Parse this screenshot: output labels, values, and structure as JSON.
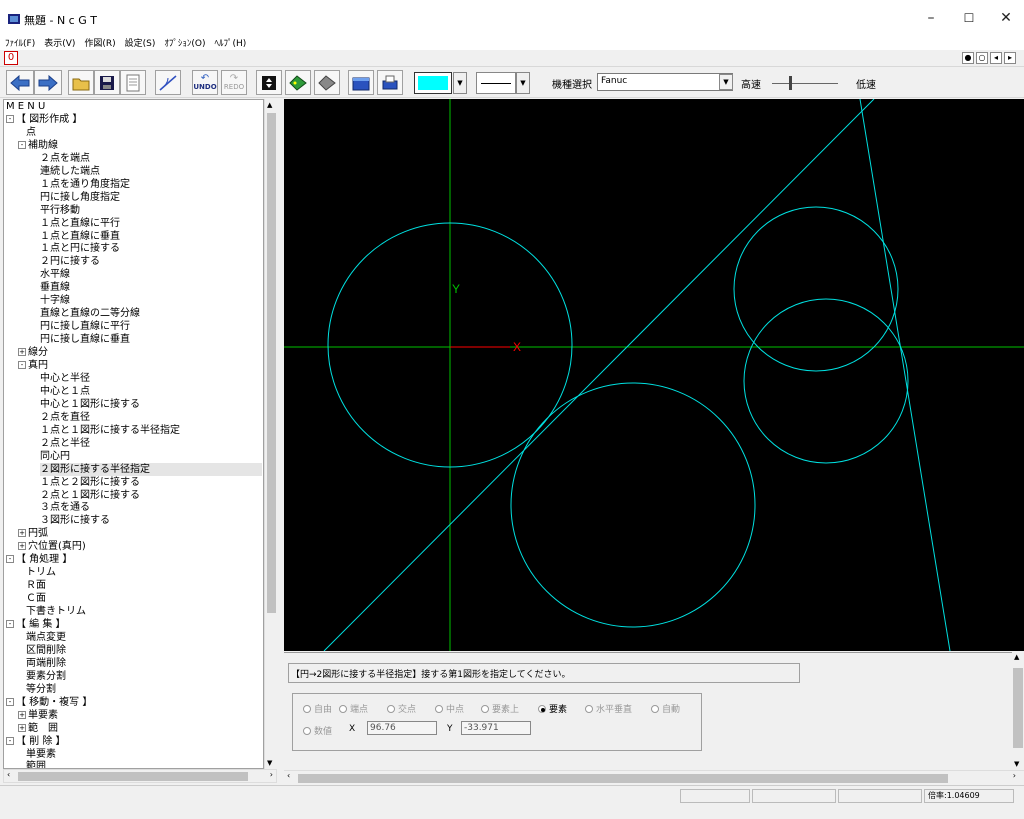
{
  "window": {
    "title": "無題 - N c G T",
    "minimize": "–",
    "maximize": "☐",
    "close": "✕"
  },
  "menu": [
    "ﾌｧｲﾙ(F)",
    "表示(V)",
    "作図(R)",
    "設定(S)",
    "ｵﾌﾟｼｮﾝ(O)",
    "ﾍﾙﾌﾟ(H)"
  ],
  "doc_tab": "0",
  "toolbar": {
    "undo_label": "UNDO",
    "redo_label": "REDO",
    "current_color": "#00ffff",
    "model_label": "機種選択",
    "model_value": "Fanuc",
    "fast_label": "高速",
    "slow_label": "低速"
  },
  "tree": {
    "items": [
      {
        "label": "M E N U",
        "indent": 0,
        "exp": ""
      },
      {
        "label": "【 図形作成 】",
        "indent": 0,
        "exp": "-"
      },
      {
        "label": "点",
        "indent": 2,
        "exp": ""
      },
      {
        "label": "補助線",
        "indent": 1,
        "exp": "-"
      },
      {
        "label": "２点を端点",
        "indent": 3,
        "exp": ""
      },
      {
        "label": "連続した端点",
        "indent": 3,
        "exp": ""
      },
      {
        "label": "１点を通り角度指定",
        "indent": 3,
        "exp": ""
      },
      {
        "label": "円に接し角度指定",
        "indent": 3,
        "exp": ""
      },
      {
        "label": "平行移動",
        "indent": 3,
        "exp": ""
      },
      {
        "label": "１点と直線に平行",
        "indent": 3,
        "exp": ""
      },
      {
        "label": "１点と直線に垂直",
        "indent": 3,
        "exp": ""
      },
      {
        "label": "１点と円に接する",
        "indent": 3,
        "exp": ""
      },
      {
        "label": "２円に接する",
        "indent": 3,
        "exp": ""
      },
      {
        "label": "水平線",
        "indent": 3,
        "exp": ""
      },
      {
        "label": "垂直線",
        "indent": 3,
        "exp": ""
      },
      {
        "label": "十字線",
        "indent": 3,
        "exp": ""
      },
      {
        "label": "直線と直線の二等分線",
        "indent": 3,
        "exp": ""
      },
      {
        "label": "円に接し直線に平行",
        "indent": 3,
        "exp": ""
      },
      {
        "label": "円に接し直線に垂直",
        "indent": 3,
        "exp": ""
      },
      {
        "label": "線分",
        "indent": 1,
        "exp": "+"
      },
      {
        "label": "真円",
        "indent": 1,
        "exp": "-"
      },
      {
        "label": "中心と半径",
        "indent": 3,
        "exp": ""
      },
      {
        "label": "中心と１点",
        "indent": 3,
        "exp": ""
      },
      {
        "label": "中心と１図形に接する",
        "indent": 3,
        "exp": ""
      },
      {
        "label": "２点を直径",
        "indent": 3,
        "exp": ""
      },
      {
        "label": "１点と１図形に接する半径指定",
        "indent": 3,
        "exp": ""
      },
      {
        "label": "２点と半径",
        "indent": 3,
        "exp": ""
      },
      {
        "label": "同心円",
        "indent": 3,
        "exp": ""
      },
      {
        "label": "２図形に接する半径指定",
        "indent": 3,
        "exp": "",
        "selected": true
      },
      {
        "label": "１点と２図形に接する",
        "indent": 3,
        "exp": ""
      },
      {
        "label": "２点と１図形に接する",
        "indent": 3,
        "exp": ""
      },
      {
        "label": "３点を通る",
        "indent": 3,
        "exp": ""
      },
      {
        "label": "３図形に接する",
        "indent": 3,
        "exp": ""
      },
      {
        "label": "円弧",
        "indent": 1,
        "exp": "+"
      },
      {
        "label": "穴位置(真円)",
        "indent": 1,
        "exp": "+"
      },
      {
        "label": "【 角処理 】",
        "indent": 0,
        "exp": "-"
      },
      {
        "label": "トリム",
        "indent": 2,
        "exp": ""
      },
      {
        "label": "Ｒ面",
        "indent": 2,
        "exp": ""
      },
      {
        "label": "Ｃ面",
        "indent": 2,
        "exp": ""
      },
      {
        "label": "下書きトリム",
        "indent": 2,
        "exp": ""
      },
      {
        "label": "【 編 集 】",
        "indent": 0,
        "exp": "-"
      },
      {
        "label": "端点変更",
        "indent": 2,
        "exp": ""
      },
      {
        "label": "区間削除",
        "indent": 2,
        "exp": ""
      },
      {
        "label": "両端削除",
        "indent": 2,
        "exp": ""
      },
      {
        "label": "要素分割",
        "indent": 2,
        "exp": ""
      },
      {
        "label": "等分割",
        "indent": 2,
        "exp": ""
      },
      {
        "label": "【 移動・複写 】",
        "indent": 0,
        "exp": "-"
      },
      {
        "label": "単要素",
        "indent": 1,
        "exp": "+"
      },
      {
        "label": "範　囲",
        "indent": 1,
        "exp": "+"
      },
      {
        "label": "【 削 除 】",
        "indent": 0,
        "exp": "-"
      },
      {
        "label": "単要素",
        "indent": 2,
        "exp": ""
      },
      {
        "label": "範囲",
        "indent": 2,
        "exp": ""
      }
    ]
  },
  "canvas": {
    "axis_y_label": "Y",
    "axis_x_label": "X"
  },
  "message": {
    "prompt": "【円→2図形に接する半径指定】接する第1図形を指定してください。"
  },
  "snap_options": [
    {
      "label": "自由",
      "active": false
    },
    {
      "label": "端点",
      "active": false
    },
    {
      "label": "交点",
      "active": false
    },
    {
      "label": "中点",
      "active": false
    },
    {
      "label": "要素上",
      "active": false
    },
    {
      "label": "要素",
      "active": true
    },
    {
      "label": "水平垂直",
      "active": false
    },
    {
      "label": "自動",
      "active": false
    }
  ],
  "numeric": {
    "label": "数値",
    "x_label": "X",
    "x_value": "96.76",
    "y_label": "Y",
    "y_value": "-33.971"
  },
  "status": {
    "zoom": "倍率:1.04609"
  }
}
